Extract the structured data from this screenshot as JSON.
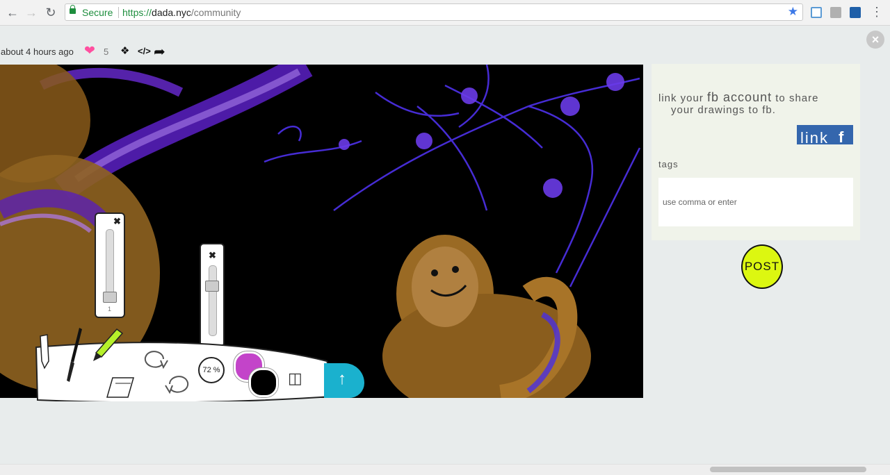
{
  "browser": {
    "secure_label": "Secure",
    "url_scheme": "https://",
    "url_host": "dada.nyc",
    "url_path": "/community",
    "accent_color": "#1e8e3e"
  },
  "post_meta": {
    "time_ago": "about 4 hours ago",
    "like_count": "5",
    "icons": [
      "heart-icon",
      "tag-icon",
      "code-icon",
      "share-icon"
    ]
  },
  "toolbar": {
    "brush_size_value": "1",
    "zoom_label": "72 %",
    "primary_color": "#c344c9",
    "secondary_color": "#000000",
    "send_color": "#1ab1ce"
  },
  "side_panel": {
    "fb_text_1": "link your ",
    "fb_text_big": "fb account",
    "fb_text_2": " to share",
    "fb_text_3": "your drawings to fb.",
    "fb_button_label": "link",
    "fb_button_icon": "f",
    "tags_label": "tags",
    "tags_placeholder": "use comma or enter",
    "post_label": "POST",
    "post_color": "#dcf711"
  }
}
